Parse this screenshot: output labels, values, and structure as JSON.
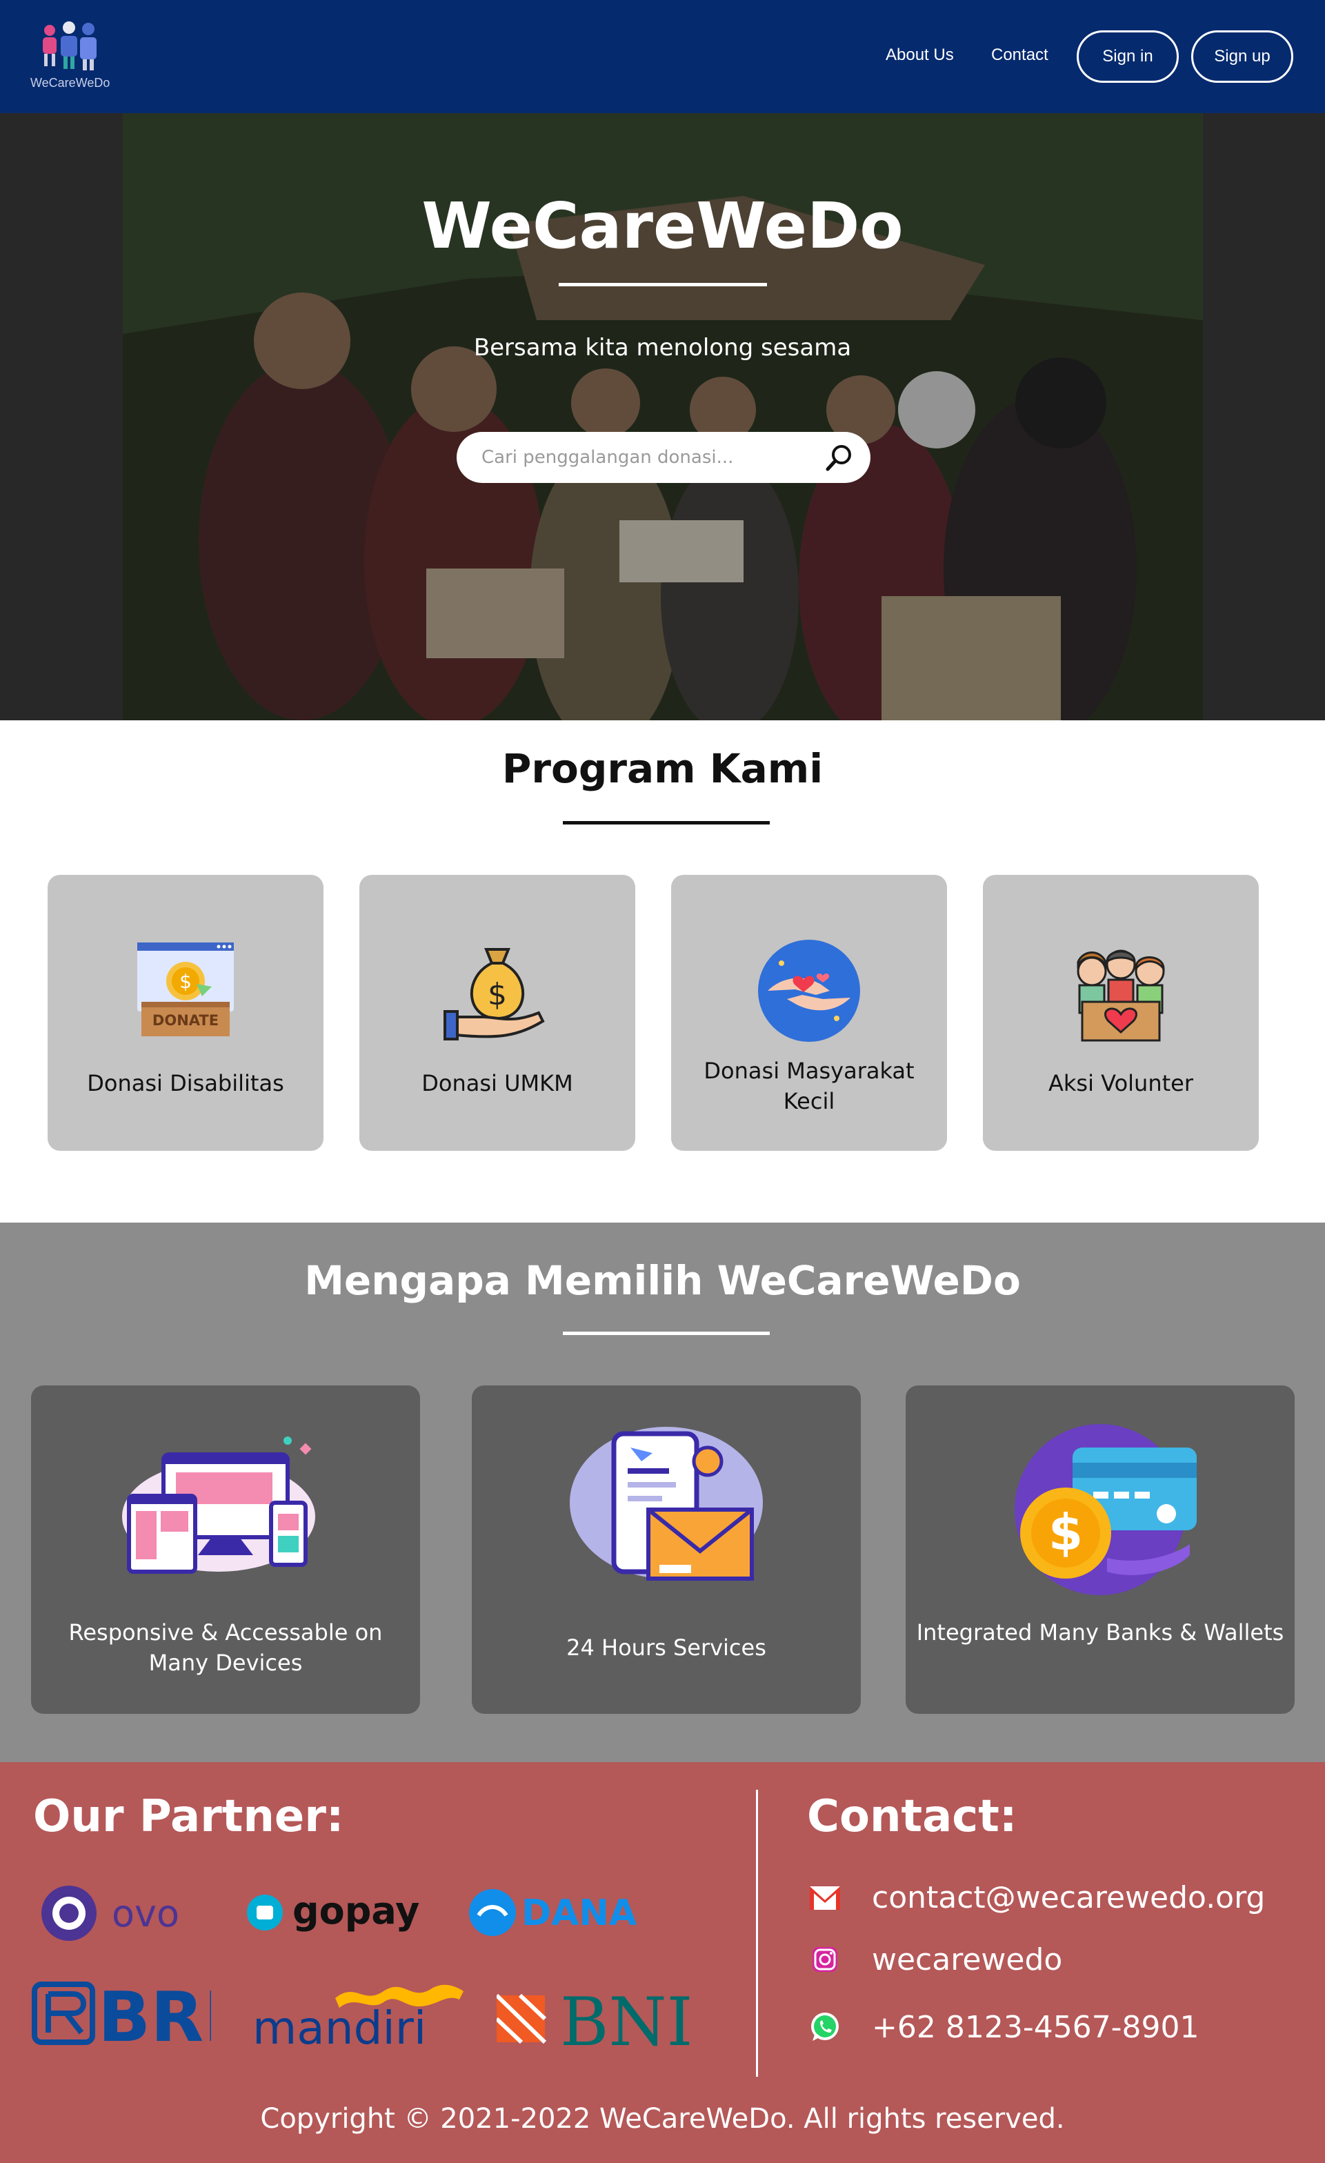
{
  "nav": {
    "logo_text": "WeCareWeDo",
    "links": [
      "About Us",
      "Contact"
    ],
    "sign_in": "Sign in",
    "sign_up": "Sign up"
  },
  "hero": {
    "title": "WeCareWeDo",
    "subtitle": "Bersama kita menolong sesama",
    "search_placeholder": "Cari penggalangan donasi..."
  },
  "program": {
    "title": "Program Kami",
    "cards": [
      {
        "label": "Donasi Disabilitas",
        "icon": "donate-box-icon",
        "donate_text": "DONATE"
      },
      {
        "label": "Donasi UMKM",
        "icon": "money-bag-hand-icon"
      },
      {
        "label": "Donasi Masyarakat Kecil",
        "icon": "hands-hearts-icon"
      },
      {
        "label": "Aksi Volunter",
        "icon": "volunteers-heart-box-icon"
      }
    ]
  },
  "why": {
    "title": "Mengapa Memilih WeCareWeDo",
    "cards": [
      {
        "label": "Responsive & Accessable on Many Devices",
        "icon": "devices-icon"
      },
      {
        "label": "24 Hours Services",
        "icon": "phone-mail-icon"
      },
      {
        "label": "Integrated Many Banks & Wallets",
        "icon": "credit-card-coin-icon"
      }
    ]
  },
  "footer": {
    "partner_title": "Our Partner:",
    "partners": [
      "ovo",
      "gopay",
      "DANA",
      "BRI",
      "mandiri",
      "BNI"
    ],
    "contact_title": "Contact:",
    "email": "contact@wecarewedo.org",
    "instagram": "wecarewedo",
    "phone": "+62 8123-4567-8901",
    "copyright": "Copyright © 2021-2022 WeCareWeDo. All rights reserved."
  },
  "colors": {
    "nav_bg": "#062a6e",
    "card_grey": "#c4c4c4",
    "why_bg": "#8c8c8c",
    "why_card": "#5e5e5e",
    "footer_bg": "#b55858"
  }
}
